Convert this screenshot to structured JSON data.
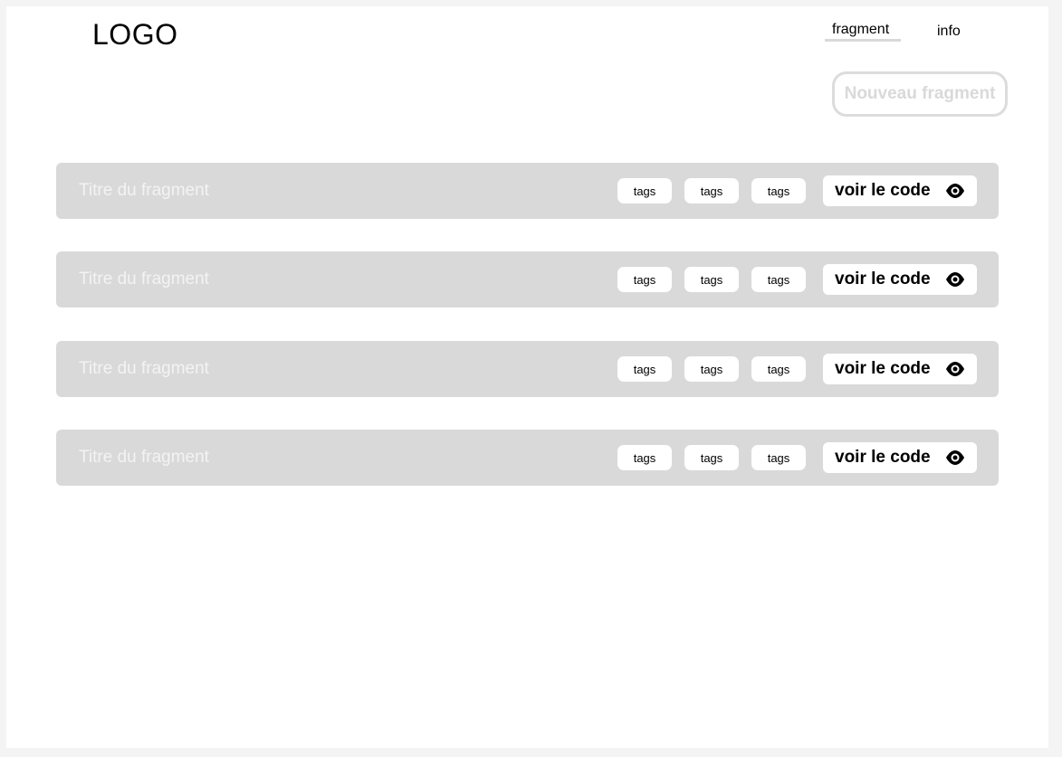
{
  "header": {
    "logo": "LOGO",
    "nav": {
      "fragment": "fragment",
      "info": "info"
    }
  },
  "actions": {
    "new_fragment": "Nouveau fragment"
  },
  "fragments": [
    {
      "title": "Titre du fragment",
      "tags": [
        "tags",
        "tags",
        "tags"
      ],
      "button": "voir le code",
      "icon": "eye-icon"
    },
    {
      "title": "Titre du fragment",
      "tags": [
        "tags",
        "tags",
        "tags"
      ],
      "button": "voir le code",
      "icon": "eye-icon"
    },
    {
      "title": "Titre du fragment",
      "tags": [
        "tags",
        "tags",
        "tags"
      ],
      "button": "voir le code",
      "icon": "eye-icon"
    },
    {
      "title": "Titre du fragment",
      "tags": [
        "tags",
        "tags",
        "tags"
      ],
      "button": "voir le code",
      "icon": "eye-icon"
    }
  ],
  "colors": {
    "row_background": "#d9d9d9",
    "muted_text": "#d9d9d9",
    "accent": "#000000"
  }
}
